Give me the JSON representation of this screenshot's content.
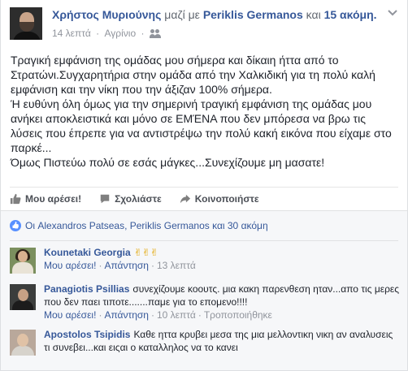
{
  "post": {
    "author": "Χρήστος Μυριούνης",
    "with_text": "μαζί με",
    "tagged_person": "Periklis Germanos",
    "and_text": "και",
    "others": "15 ακόμη.",
    "time": "14 λεπτά",
    "location": "Αγρίνιο",
    "privacy_icon": "friends-icon",
    "body_lines": [
      "Τραγική εμφάνιση της ομάδας μου σήμερα και δίκαιη ήττα από το Στρατώνι.Συγχαρητήρια στην ομάδα από την Χαλκιδική για τη πολύ καλή εμφάνιση και την νίκη που την άξιζαν 100% σήμερα.",
      "Ή ευθύνη όλη όμως για την σημερινή τραγική εμφάνιση της ομάδας μου ανήκει αποκλειστικά και μόνο σε ΕΜΈΝΑ που δεν μπόρεσα να βρω τις λύσεις που έπρεπε για να αντιστρέψω την πολύ κακή εικόνα που είχαμε στο παρκέ...",
      "Όμως Πιστεύω πολύ σε εσάς μάγκες...Συνεχίζουμε μη μασατε!"
    ]
  },
  "actions": {
    "like": "Μου αρέσει!",
    "comment": "Σχολιάστε",
    "share": "Κοινοποιήστε"
  },
  "likes_summary": "Οι Alexandros Patseas, Periklis Germanos και 30 ακόμη",
  "comments": [
    {
      "name": "Kounetaki Georgia",
      "text": "✌✌✌",
      "like": "Μου αρέσει!",
      "reply": "Απάντηση",
      "time": "13 λεπτά",
      "edit": ""
    },
    {
      "name": "Panagiotis Psillias",
      "text": "συνεχίζουμε κοουτς. μια κακη παρενθεση ηταν...απο τις μερες που δεν παει τιποτε.......παμε για το επομενο!!!!",
      "like": "Μου αρέσει!",
      "reply": "Απάντηση",
      "time": "10 λεπτά",
      "edit": "Τροποποιήθηκε"
    },
    {
      "name": "Apostolos Tsipidis",
      "text": "Καθε ηττα κρυβει μεσα της μια μελλοντικη νικη αν αναλυσεις τι συνεβει...και ειςαι ο καταλληλος να το κανει",
      "like": "",
      "reply": "",
      "time": "",
      "edit": ""
    }
  ],
  "colors": {
    "link": "#365899",
    "text": "#1d2129",
    "meta": "#90949c",
    "feedback_bg": "#f6f7f9",
    "like_badge": "#5890ff"
  }
}
